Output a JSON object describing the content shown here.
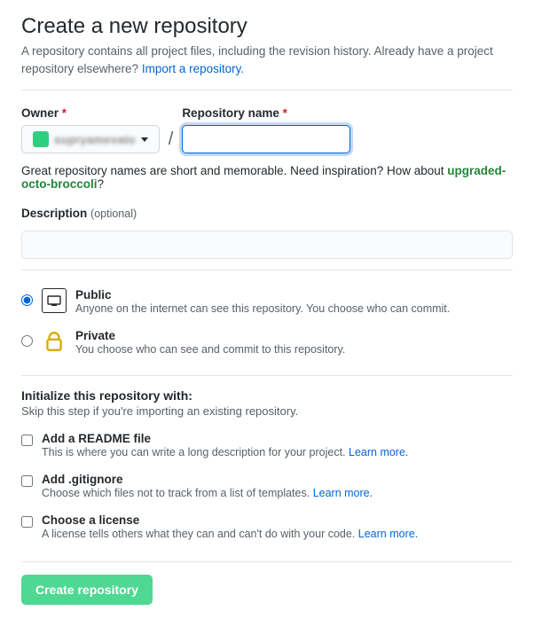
{
  "header": {
    "title": "Create a new repository",
    "subtitle": "A repository contains all project files, including the revision history. Already have a project repository elsewhere?",
    "import_link": "Import a repository."
  },
  "owner": {
    "label": "Owner",
    "username": "supryamevato"
  },
  "repo_name": {
    "label": "Repository name",
    "value": ""
  },
  "inspiration": {
    "prefix": "Great repository names are short and memorable. Need inspiration? How about ",
    "suggestion": "upgraded-octo-broccoli",
    "suffix": "?"
  },
  "description": {
    "label": "Description",
    "optional": "(optional)",
    "value": ""
  },
  "visibility": {
    "public": {
      "title": "Public",
      "desc": "Anyone on the internet can see this repository. You choose who can commit."
    },
    "private": {
      "title": "Private",
      "desc": "You choose who can see and commit to this repository."
    }
  },
  "init": {
    "heading": "Initialize this repository with:",
    "sub": "Skip this step if you're importing an existing repository.",
    "readme": {
      "title": "Add a README file",
      "desc": "This is where you can write a long description for your project. ",
      "link": "Learn more."
    },
    "gitignore": {
      "title": "Add .gitignore",
      "desc": "Choose which files not to track from a list of templates. ",
      "link": "Learn more."
    },
    "license": {
      "title": "Choose a license",
      "desc": "A license tells others what they can and can't do with your code. ",
      "link": "Learn more."
    }
  },
  "submit": {
    "label": "Create repository"
  }
}
